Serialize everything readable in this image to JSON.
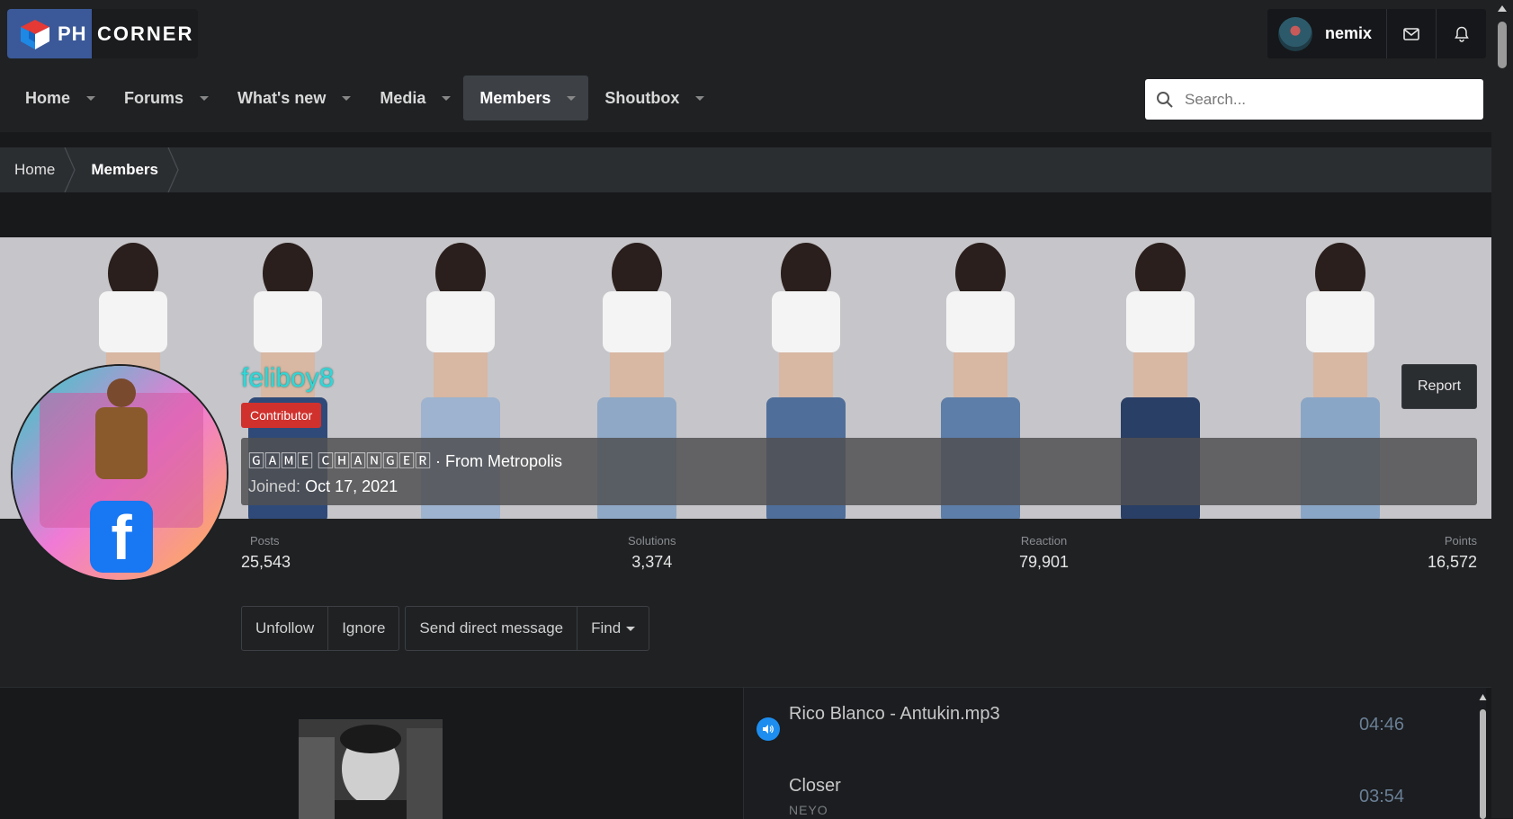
{
  "brand": {
    "ph": "PH",
    "corner": "CORNER"
  },
  "user": {
    "name": "nemix"
  },
  "nav": {
    "tabs": [
      {
        "label": "Home"
      },
      {
        "label": "Forums"
      },
      {
        "label": "What's new"
      },
      {
        "label": "Media"
      },
      {
        "label": "Members",
        "active": true
      },
      {
        "label": "Shoutbox"
      }
    ],
    "search_placeholder": "Search..."
  },
  "breadcrumb": [
    "Home",
    "Members"
  ],
  "profile": {
    "username": "feliboy8",
    "badge": "Contributor",
    "tagline_title": "🄶🄰🄼🄴 🄲🄷🄰🄽🄶🄴🅁",
    "tagline_from": " · From Metropolis",
    "joined_label": "Joined:",
    "joined_date": "Oct 17, 2021",
    "report_label": "Report",
    "stats": [
      {
        "label": "Posts",
        "value": "25,543"
      },
      {
        "label": "Solutions",
        "value": "3,374"
      },
      {
        "label": "Reaction",
        "value": "79,901"
      },
      {
        "label": "Points",
        "value": "16,572"
      }
    ],
    "actions": {
      "unfollow": "Unfollow",
      "ignore": "Ignore",
      "send_dm": "Send direct message",
      "find": "Find"
    }
  },
  "playlist": {
    "tracks": [
      {
        "title": "Rico Blanco - Antukin.mp3",
        "subtitle": "",
        "duration": "04:46"
      },
      {
        "title": "Closer",
        "subtitle": "NEYO",
        "duration": "03:54"
      }
    ]
  },
  "colors": {
    "accent": "#3b5998",
    "username": "#2fd7d7",
    "badge": "#d0312d",
    "speaker": "#1d8ef0"
  }
}
